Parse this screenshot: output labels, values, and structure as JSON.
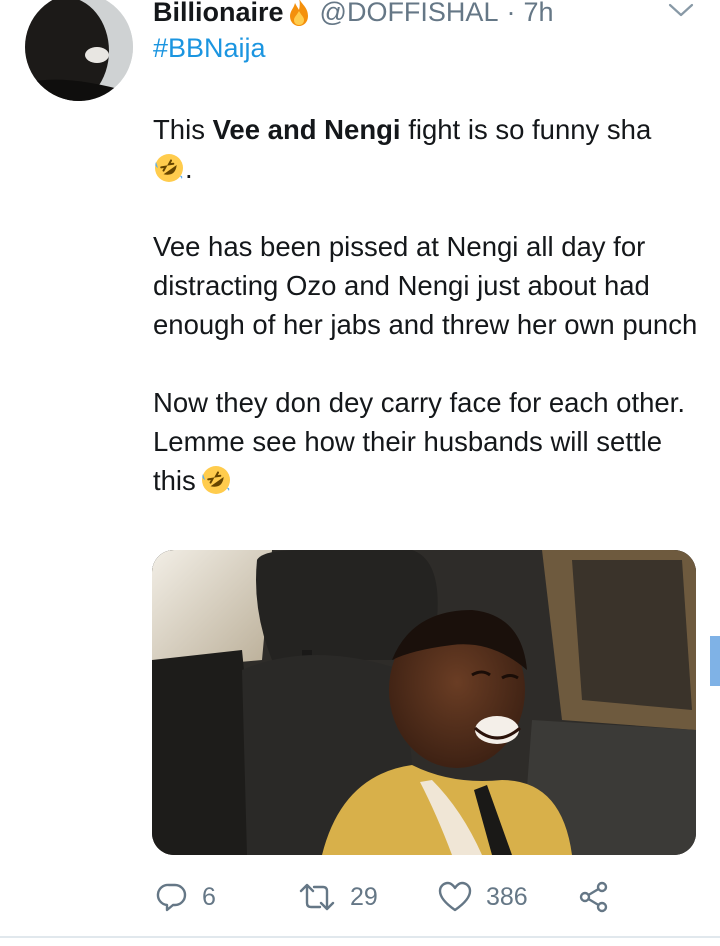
{
  "tweet": {
    "author": {
      "display_name": "Billionaire",
      "handle": "@DOFFISHAL",
      "badge_icon": "fire-icon"
    },
    "separator": "·",
    "time": "7h",
    "hashtag": "#BBNaija",
    "body": {
      "p1_pre": "This ",
      "p1_bold": "Vee and Nengi",
      "p1_post": " fight is so funny sha",
      "p1_tail": ".",
      "p2": "Vee has been pissed at Nengi all day for distracting Ozo and Nengi just about had enough of her jabs and threw her own punch",
      "p3": "Now they don dey carry face for each other. Lemme see how their husbands will settle this"
    },
    "emoji_icon": "rolling-on-floor-laughing-emoji",
    "media": {
      "description_icon": "photo-child-laughing-in-car"
    },
    "actions": {
      "replies": "6",
      "retweets": "29",
      "likes": "386"
    }
  },
  "colors": {
    "text": "#14171a",
    "muted": "#657786",
    "link": "#1b95e0",
    "divider": "#e1e8ed",
    "side_marker": "#7fb2e6"
  }
}
